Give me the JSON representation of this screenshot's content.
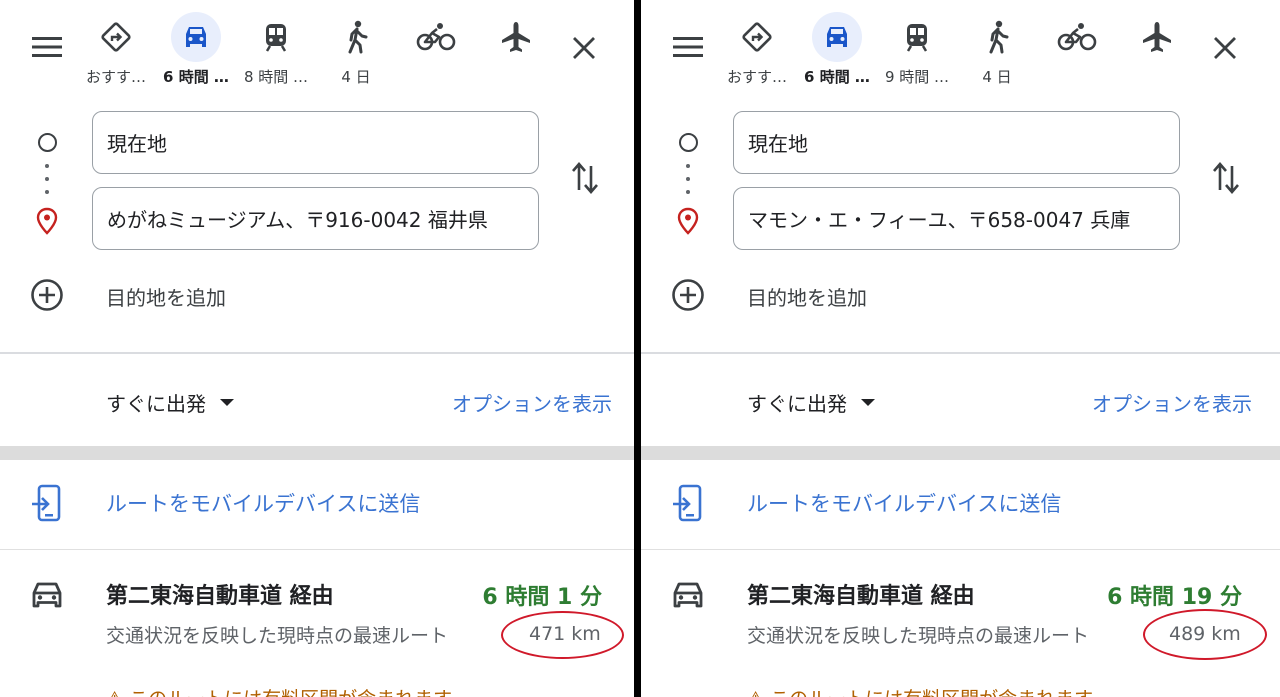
{
  "panels": [
    {
      "modes": [
        {
          "label": "おすす…",
          "icon": "directions-diamond-icon"
        },
        {
          "label": "6 時間 …",
          "icon": "car-icon",
          "active": true
        },
        {
          "label": "8 時間 …",
          "icon": "train-icon"
        },
        {
          "label": "4 日",
          "icon": "walk-icon"
        },
        {
          "label": "",
          "icon": "bike-icon"
        },
        {
          "label": "",
          "icon": "flight-icon"
        }
      ],
      "origin": "現在地",
      "destination": "めがねミュージアム、〒916-0042 福井県",
      "add_destination": "目的地を追加",
      "depart": "すぐに出発",
      "options": "オプションを表示",
      "send": "ルートをモバイルデバイスに送信",
      "route": {
        "name": "第二東海自動車道 経由",
        "duration": "6 時間 1 分",
        "description": "交通状況を反映した現時点の最速ルート",
        "distance": "471 km",
        "toll": "⚠ このルートには有料区間が含まれます"
      }
    },
    {
      "modes": [
        {
          "label": "おすす…",
          "icon": "directions-diamond-icon"
        },
        {
          "label": "6 時間 …",
          "icon": "car-icon",
          "active": true
        },
        {
          "label": "9 時間 …",
          "icon": "train-icon"
        },
        {
          "label": "4 日",
          "icon": "walk-icon"
        },
        {
          "label": "",
          "icon": "bike-icon"
        },
        {
          "label": "",
          "icon": "flight-icon"
        }
      ],
      "origin": "現在地",
      "destination": "マモン・エ・フィーユ、〒658-0047 兵庫",
      "add_destination": "目的地を追加",
      "depart": "すぐに出発",
      "options": "オプションを表示",
      "send": "ルートをモバイルデバイスに送信",
      "route": {
        "name": "第二東海自動車道 経由",
        "duration": "6 時間 19 分",
        "description": "交通状況を反映した現時点の最速ルート",
        "distance": "489 km",
        "toll": "⚠ このルートには有料区間が含まれます"
      }
    }
  ],
  "colors": {
    "accent_blue": "#3a73d1",
    "active_mode_bg": "#e8eefc",
    "duration_green": "#2e7d32",
    "highlight_red": "#d0192a",
    "pin_red": "#c5221f"
  }
}
